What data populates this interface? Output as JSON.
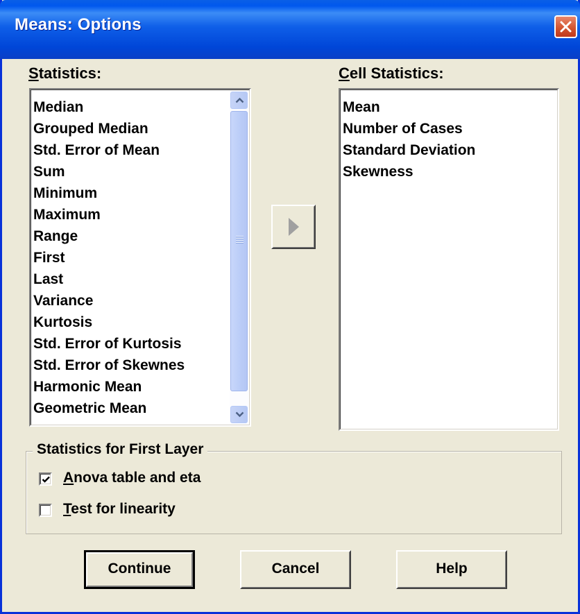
{
  "window": {
    "title": "Means: Options"
  },
  "statistics": {
    "label_accel": "S",
    "label_rest": "tatistics:",
    "items": [
      "Median",
      "Grouped Median",
      "Std. Error of Mean",
      "Sum",
      "Minimum",
      "Maximum",
      "Range",
      "First",
      "Last",
      "Variance",
      "Kurtosis",
      "Std. Error of Kurtosis",
      "Std. Error of Skewnes",
      "Harmonic Mean",
      "Geometric Mean"
    ]
  },
  "cell_statistics": {
    "label_accel": "C",
    "label_rest": "ell Statistics:",
    "items": [
      "Mean",
      "Number of Cases",
      "Standard Deviation",
      "Skewness"
    ]
  },
  "first_layer": {
    "title": "Statistics for First Layer",
    "anova": {
      "accel": "A",
      "rest": "nova table and eta",
      "checked": true
    },
    "linearity": {
      "accel": "T",
      "rest": "est for linearity",
      "checked": false
    }
  },
  "buttons": {
    "continue": "Continue",
    "cancel": "Cancel",
    "help": "Help"
  },
  "icons": {
    "close": "close-icon",
    "move": "right-arrow-icon",
    "scroll_up": "chevron-up-icon",
    "scroll_down": "chevron-down-icon"
  }
}
